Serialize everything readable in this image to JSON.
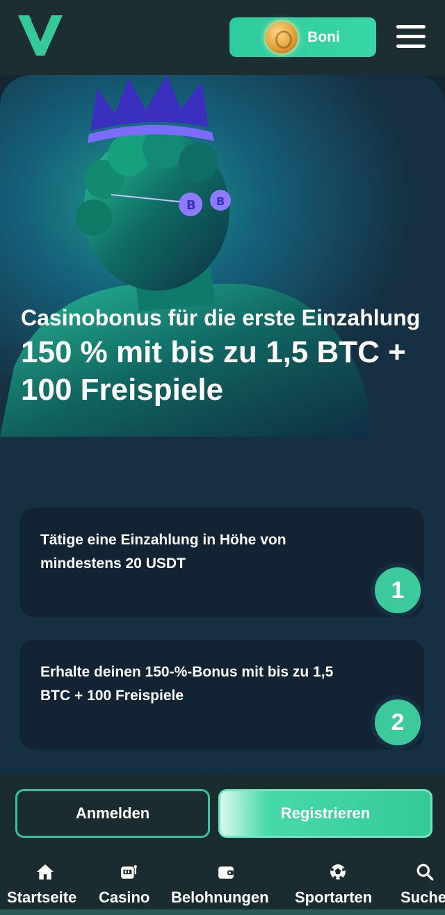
{
  "header": {
    "logo": "vave-v-logo",
    "bonus_button_label": "Boni",
    "bonus_icon": "gold-coin-icon",
    "menu_icon": "hamburger-menu-icon"
  },
  "hero": {
    "subtitle": "Casinobonus für die erste Einzahlung",
    "title": "150 % mit bis zu 1,5 BTC + 100 Freispiele"
  },
  "steps": [
    {
      "number": "1",
      "text": "Tätige eine Einzahlung in Höhe von mindestens 20 USDT"
    },
    {
      "number": "2",
      "text": "Erhalte deinen 150-%-Bonus mit bis zu 1,5 BTC + 100 Freispiele"
    }
  ],
  "cta": {
    "login_label": "Anmelden",
    "register_label": "Registrieren"
  },
  "nav": {
    "items": [
      {
        "label": "Startseite",
        "icon": "home-icon"
      },
      {
        "label": "Casino",
        "icon": "slot-machine-icon"
      },
      {
        "label": "Belohnungen",
        "icon": "wallet-icon"
      },
      {
        "label": "Sportarten",
        "icon": "soccer-ball-icon"
      },
      {
        "label": "Suche",
        "icon": "search-icon"
      }
    ]
  },
  "colors": {
    "accent": "#35c99a",
    "background": "#14262f",
    "card": "#122433"
  }
}
